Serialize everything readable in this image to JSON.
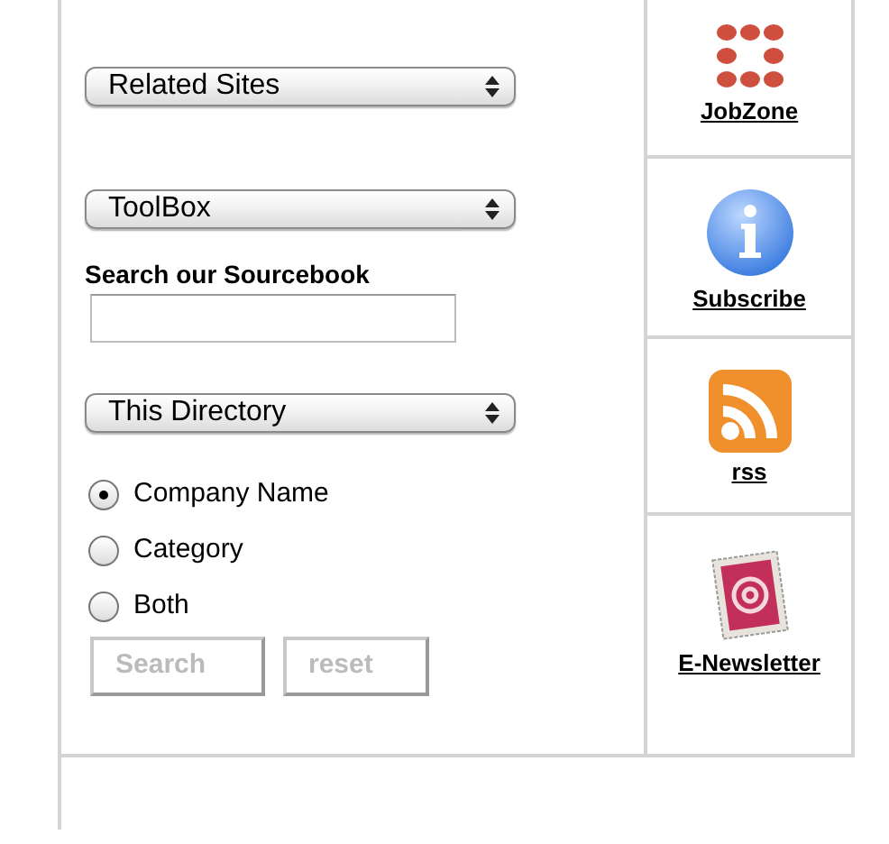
{
  "selects": [
    {
      "value": "Related Sites"
    },
    {
      "value": "ToolBox"
    }
  ],
  "search": {
    "label": "Search our Sourcebook",
    "scope": "This Directory"
  },
  "radios": [
    {
      "label": "Company Name",
      "selected": true
    },
    {
      "label": "Category",
      "selected": false
    },
    {
      "label": "Both",
      "selected": false
    }
  ],
  "buttons": [
    "Search",
    "reset"
  ],
  "links": [
    {
      "kind": "dots",
      "label": "JobZone"
    },
    {
      "kind": "info",
      "label": "Subscribe"
    },
    {
      "kind": "rss",
      "label": "rss"
    },
    {
      "kind": "stamp",
      "label": "E-Newsletter"
    }
  ]
}
